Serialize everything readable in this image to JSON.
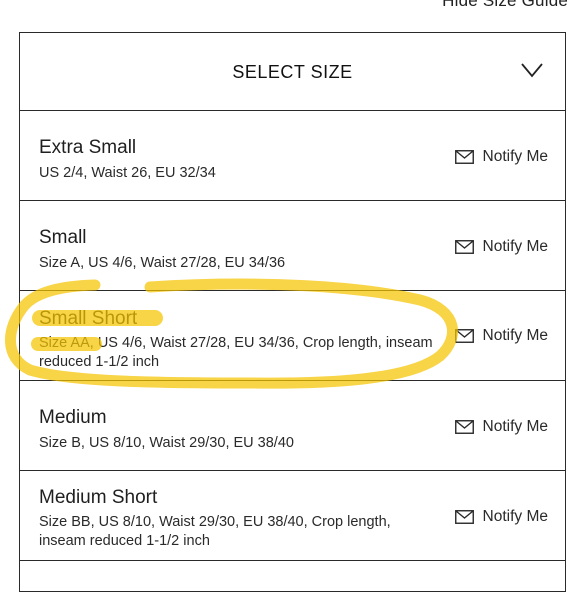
{
  "hide_size_guide": "Hide Size Guide",
  "selector": {
    "title": "SELECT SIZE",
    "chevron_icon": "chevron-down-icon"
  },
  "notify_icon": "mail-icon",
  "sizes": [
    {
      "name": "Extra Small",
      "description": "US 2/4, Waist 26, EU 32/34",
      "notify": "Notify Me"
    },
    {
      "name": "Small",
      "description": "Size A, US 4/6, Waist 27/28, EU 34/36",
      "notify": "Notify Me"
    },
    {
      "name": "Small Short",
      "description": "Size AA, US 4/6, Waist 27/28, EU 34/36, Crop length, inseam reduced 1-1/2 inch",
      "notify": "Notify Me"
    },
    {
      "name": "Medium",
      "description": "Size B, US 8/10, Waist 29/30, EU 38/40",
      "notify": "Notify Me"
    },
    {
      "name": "Medium Short",
      "description": "Size BB, US 8/10, Waist 29/30, EU 38/40, Crop length, inseam reduced 1-1/2 inch",
      "notify": "Notify Me"
    }
  ],
  "colors": {
    "highlight": "#f5c400",
    "border": "#2a2a2a"
  }
}
